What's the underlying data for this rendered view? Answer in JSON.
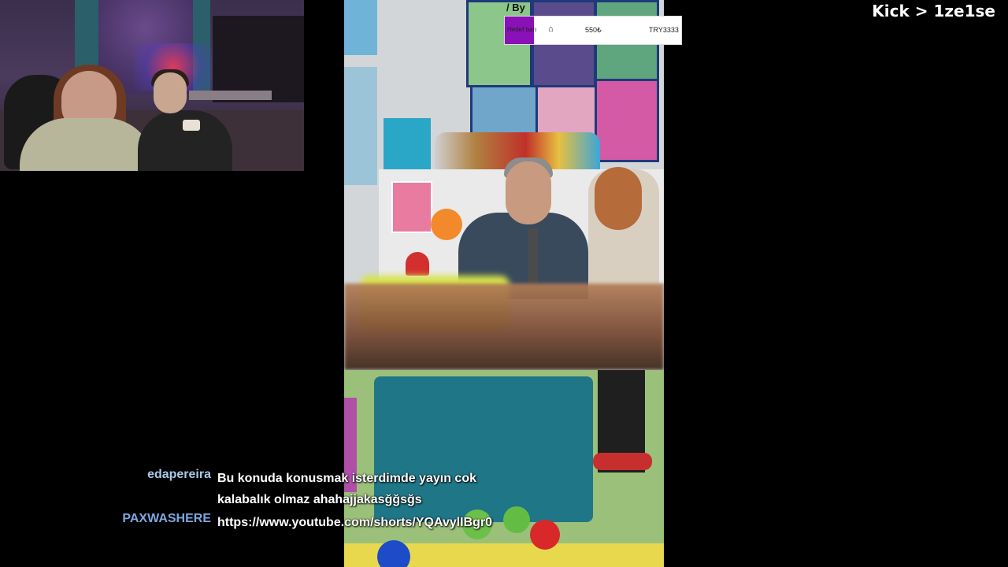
{
  "channel_tag": "Kick > 1ze1se",
  "goal": {
    "by_text": "/ By",
    "label": "Hedef barı",
    "icon": "house-icon",
    "current": "550₺",
    "target": "TRY3333",
    "progress": 0.165,
    "fill_color": "#8a10b8"
  },
  "chat": {
    "messages": [
      {
        "user": "edapereira",
        "user_color": "#a9c8e8",
        "text": "Bu konuda konusmak isterdimde yayın cok kalabalık olmaz ahahajjakasğğsğs"
      },
      {
        "user": "PAXWASHERE",
        "user_color": "#7da7e0",
        "text": "https://www.youtube.com/shorts/YQAvylIBgr0"
      }
    ]
  }
}
